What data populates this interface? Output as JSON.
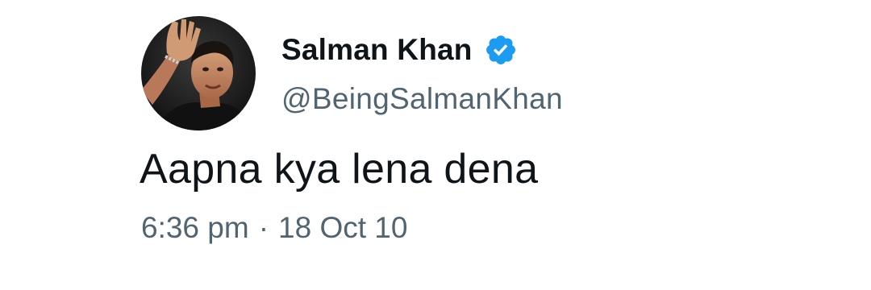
{
  "author": {
    "display_name": "Salman Khan",
    "handle": "@BeingSalmanKhan",
    "verified_icon": "verified-badge-icon",
    "avatar_icon": "profile-photo"
  },
  "tweet": {
    "text": "Aapna kya lena dena",
    "time": "6:36 pm",
    "separator": "·",
    "date": "18 Oct 10"
  },
  "colors": {
    "primary_text": "#0f1419",
    "secondary_text": "#536471",
    "verified_blue": "#1d9bf0",
    "background": "#ffffff"
  }
}
